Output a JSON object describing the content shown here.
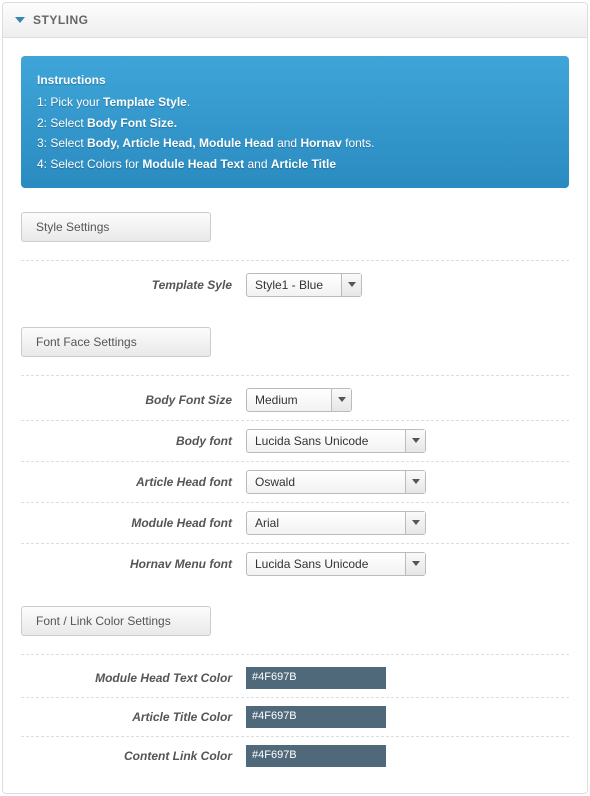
{
  "panel_title": "STYLING",
  "instructions": {
    "title": "Instructions",
    "l1_pre": "1: Pick your ",
    "l1_b": "Template Style",
    "l1_post": ".",
    "l2_pre": "2: Select ",
    "l2_b": "Body Font Size.",
    "l3_pre": "3: Select ",
    "l3_b1": "Body, Article Head, Module Head",
    "l3_mid": " and ",
    "l3_b2": "Hornav",
    "l3_post": " fonts.",
    "l4_pre": "4: Select Colors for ",
    "l4_b1": "Module Head Text",
    "l4_mid": " and ",
    "l4_b2": "Article Title"
  },
  "sections": {
    "style": "Style Settings",
    "font": "Font Face Settings",
    "color": "Font / Link Color Settings"
  },
  "labels": {
    "template_style": "Template Syle",
    "body_font_size": "Body Font Size",
    "body_font": "Body font",
    "article_head_font": "Article Head font",
    "module_head_font": "Module Head font",
    "hornav_font": "Hornav Menu font",
    "module_head_text_color": "Module Head Text Color",
    "article_title_color": "Article Title Color",
    "content_link_color": "Content Link Color"
  },
  "values": {
    "template_style": "Style1 - Blue",
    "body_font_size": "Medium",
    "body_font": "Lucida Sans Unicode",
    "article_head_font": "Oswald",
    "module_head_font": "Arial",
    "hornav_font": "Lucida Sans Unicode",
    "module_head_text_color": "#4F697B",
    "article_title_color": "#4F697B",
    "content_link_color": "#4F697B"
  },
  "colors": {
    "swatch": "#4f697b"
  }
}
